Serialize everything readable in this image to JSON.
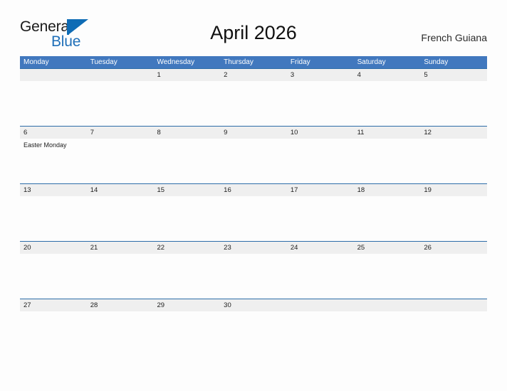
{
  "colors": {
    "header_blue": "#4178be",
    "rule_blue": "#2c6ca8",
    "stripe_gray": "#efefef",
    "logo_blue": "#1f6fb8",
    "page_background": "#fdfdfd"
  },
  "logo": {
    "word_general": "General",
    "word_blue": "Blue",
    "mark": "triangle-flag-icon"
  },
  "header": {
    "title": "April 2026",
    "region": "French Guiana"
  },
  "calendar": {
    "month": "April",
    "year": "2026",
    "weekday_headers": [
      "Monday",
      "Tuesday",
      "Wednesday",
      "Thursday",
      "Friday",
      "Saturday",
      "Sunday"
    ],
    "weeks": [
      {
        "days": [
          {
            "num": "",
            "events": []
          },
          {
            "num": "",
            "events": []
          },
          {
            "num": "1",
            "events": []
          },
          {
            "num": "2",
            "events": []
          },
          {
            "num": "3",
            "events": []
          },
          {
            "num": "4",
            "events": []
          },
          {
            "num": "5",
            "events": []
          }
        ]
      },
      {
        "days": [
          {
            "num": "6",
            "events": [
              "Easter Monday"
            ]
          },
          {
            "num": "7",
            "events": []
          },
          {
            "num": "8",
            "events": []
          },
          {
            "num": "9",
            "events": []
          },
          {
            "num": "10",
            "events": []
          },
          {
            "num": "11",
            "events": []
          },
          {
            "num": "12",
            "events": []
          }
        ]
      },
      {
        "days": [
          {
            "num": "13",
            "events": []
          },
          {
            "num": "14",
            "events": []
          },
          {
            "num": "15",
            "events": []
          },
          {
            "num": "16",
            "events": []
          },
          {
            "num": "17",
            "events": []
          },
          {
            "num": "18",
            "events": []
          },
          {
            "num": "19",
            "events": []
          }
        ]
      },
      {
        "days": [
          {
            "num": "20",
            "events": []
          },
          {
            "num": "21",
            "events": []
          },
          {
            "num": "22",
            "events": []
          },
          {
            "num": "23",
            "events": []
          },
          {
            "num": "24",
            "events": []
          },
          {
            "num": "25",
            "events": []
          },
          {
            "num": "26",
            "events": []
          }
        ]
      },
      {
        "days": [
          {
            "num": "27",
            "events": []
          },
          {
            "num": "28",
            "events": []
          },
          {
            "num": "29",
            "events": []
          },
          {
            "num": "30",
            "events": []
          },
          {
            "num": "",
            "events": []
          },
          {
            "num": "",
            "events": []
          },
          {
            "num": "",
            "events": []
          }
        ]
      }
    ]
  }
}
